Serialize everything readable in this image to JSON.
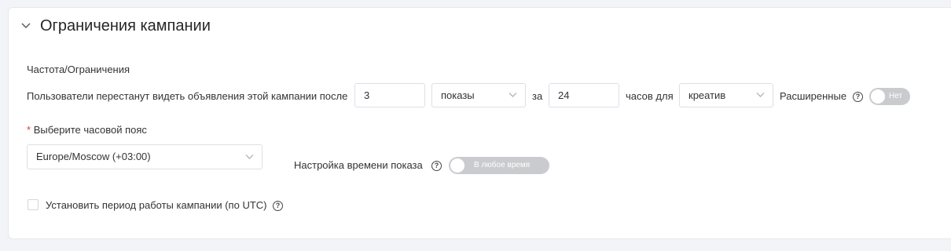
{
  "section": {
    "title": "Ограничения кампании"
  },
  "frequency": {
    "heading": "Частота/Ограничения",
    "sentence_start": "Пользователи перестанут видеть объявления этой кампании после",
    "count_value": "3",
    "unit_selected": "показы",
    "word_za": "за",
    "hours_value": "24",
    "hours_for": "часов для",
    "target_selected": "креатив",
    "advanced_label": "Расширенные",
    "advanced_toggle_text": "Нет"
  },
  "timezone": {
    "required_mark": "*",
    "label": "Выберите часовой пояс",
    "selected": "Europe/Moscow (+03:00)"
  },
  "schedule": {
    "label": "Настройка времени показа",
    "toggle_text": "В любое время"
  },
  "period": {
    "checkbox_label": "Установить период работы кампании (по UTC)",
    "checked": false
  },
  "colors": {
    "page_bg": "#f3f4f7",
    "card_bg": "#ffffff",
    "toggle_off": "#c9cbcf",
    "required": "#e53935"
  },
  "icons": [
    "chevron-down-icon",
    "help-circle-icon"
  ]
}
